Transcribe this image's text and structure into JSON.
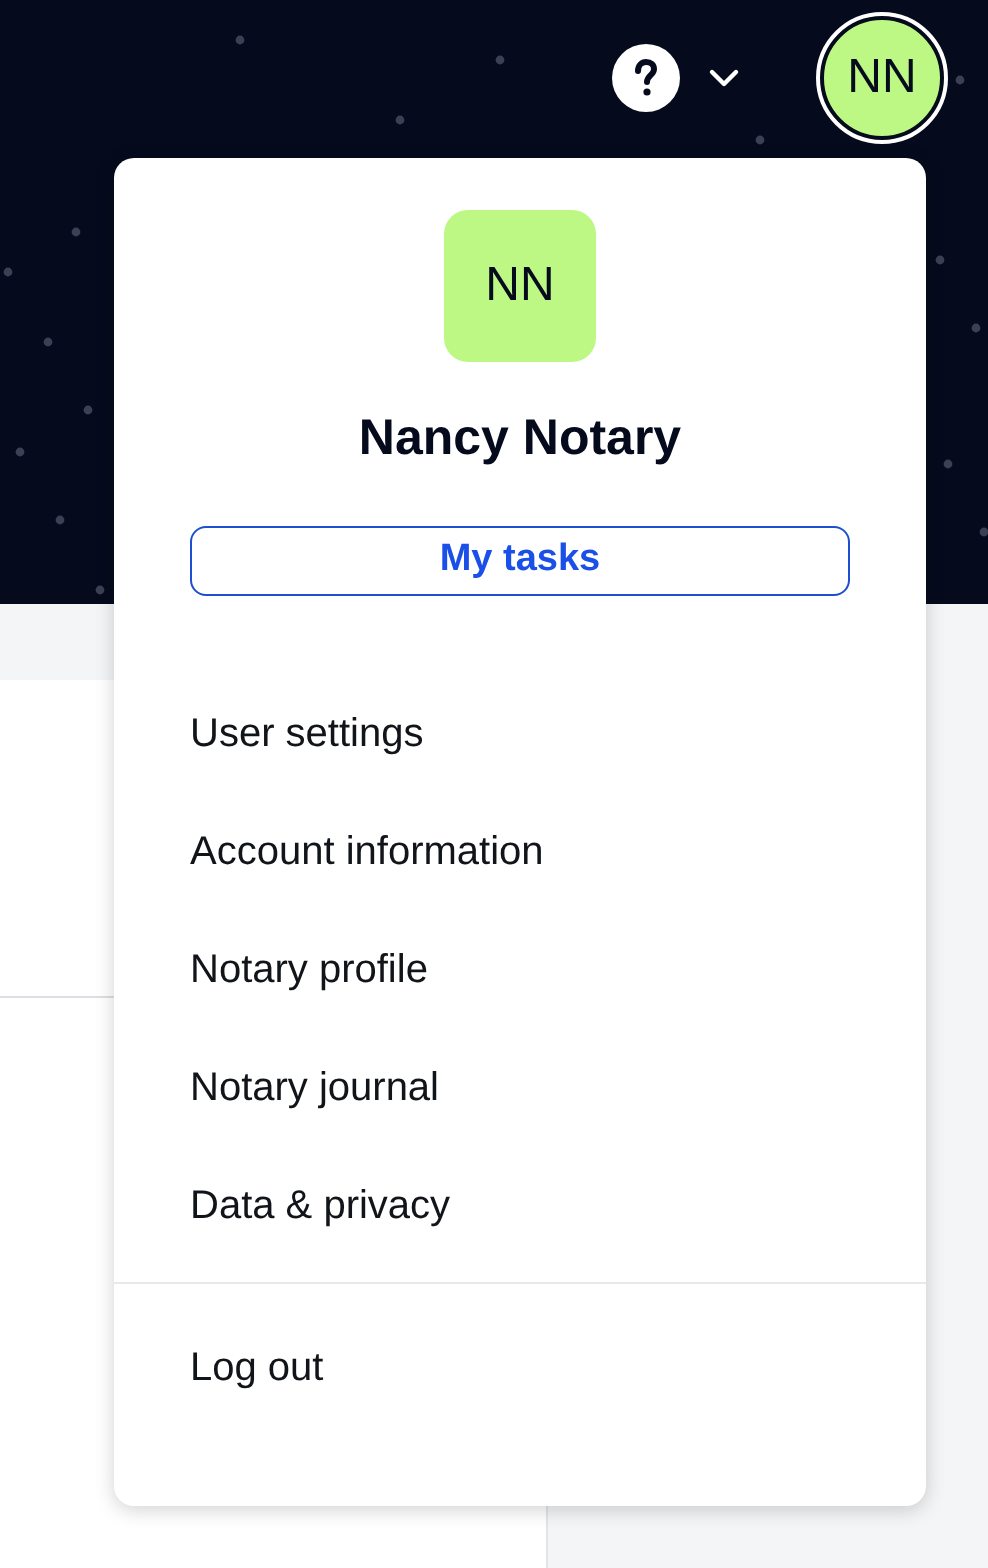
{
  "header": {
    "avatar_initials": "NN"
  },
  "account_menu": {
    "avatar_initials": "NN",
    "user_name": "Nancy Notary",
    "primary_action": "My tasks",
    "items": [
      {
        "label": "User settings"
      },
      {
        "label": "Account information"
      },
      {
        "label": "Notary profile"
      },
      {
        "label": "Notary journal"
      },
      {
        "label": "Data & privacy"
      }
    ],
    "footer_items": [
      {
        "label": "Log out"
      }
    ]
  }
}
